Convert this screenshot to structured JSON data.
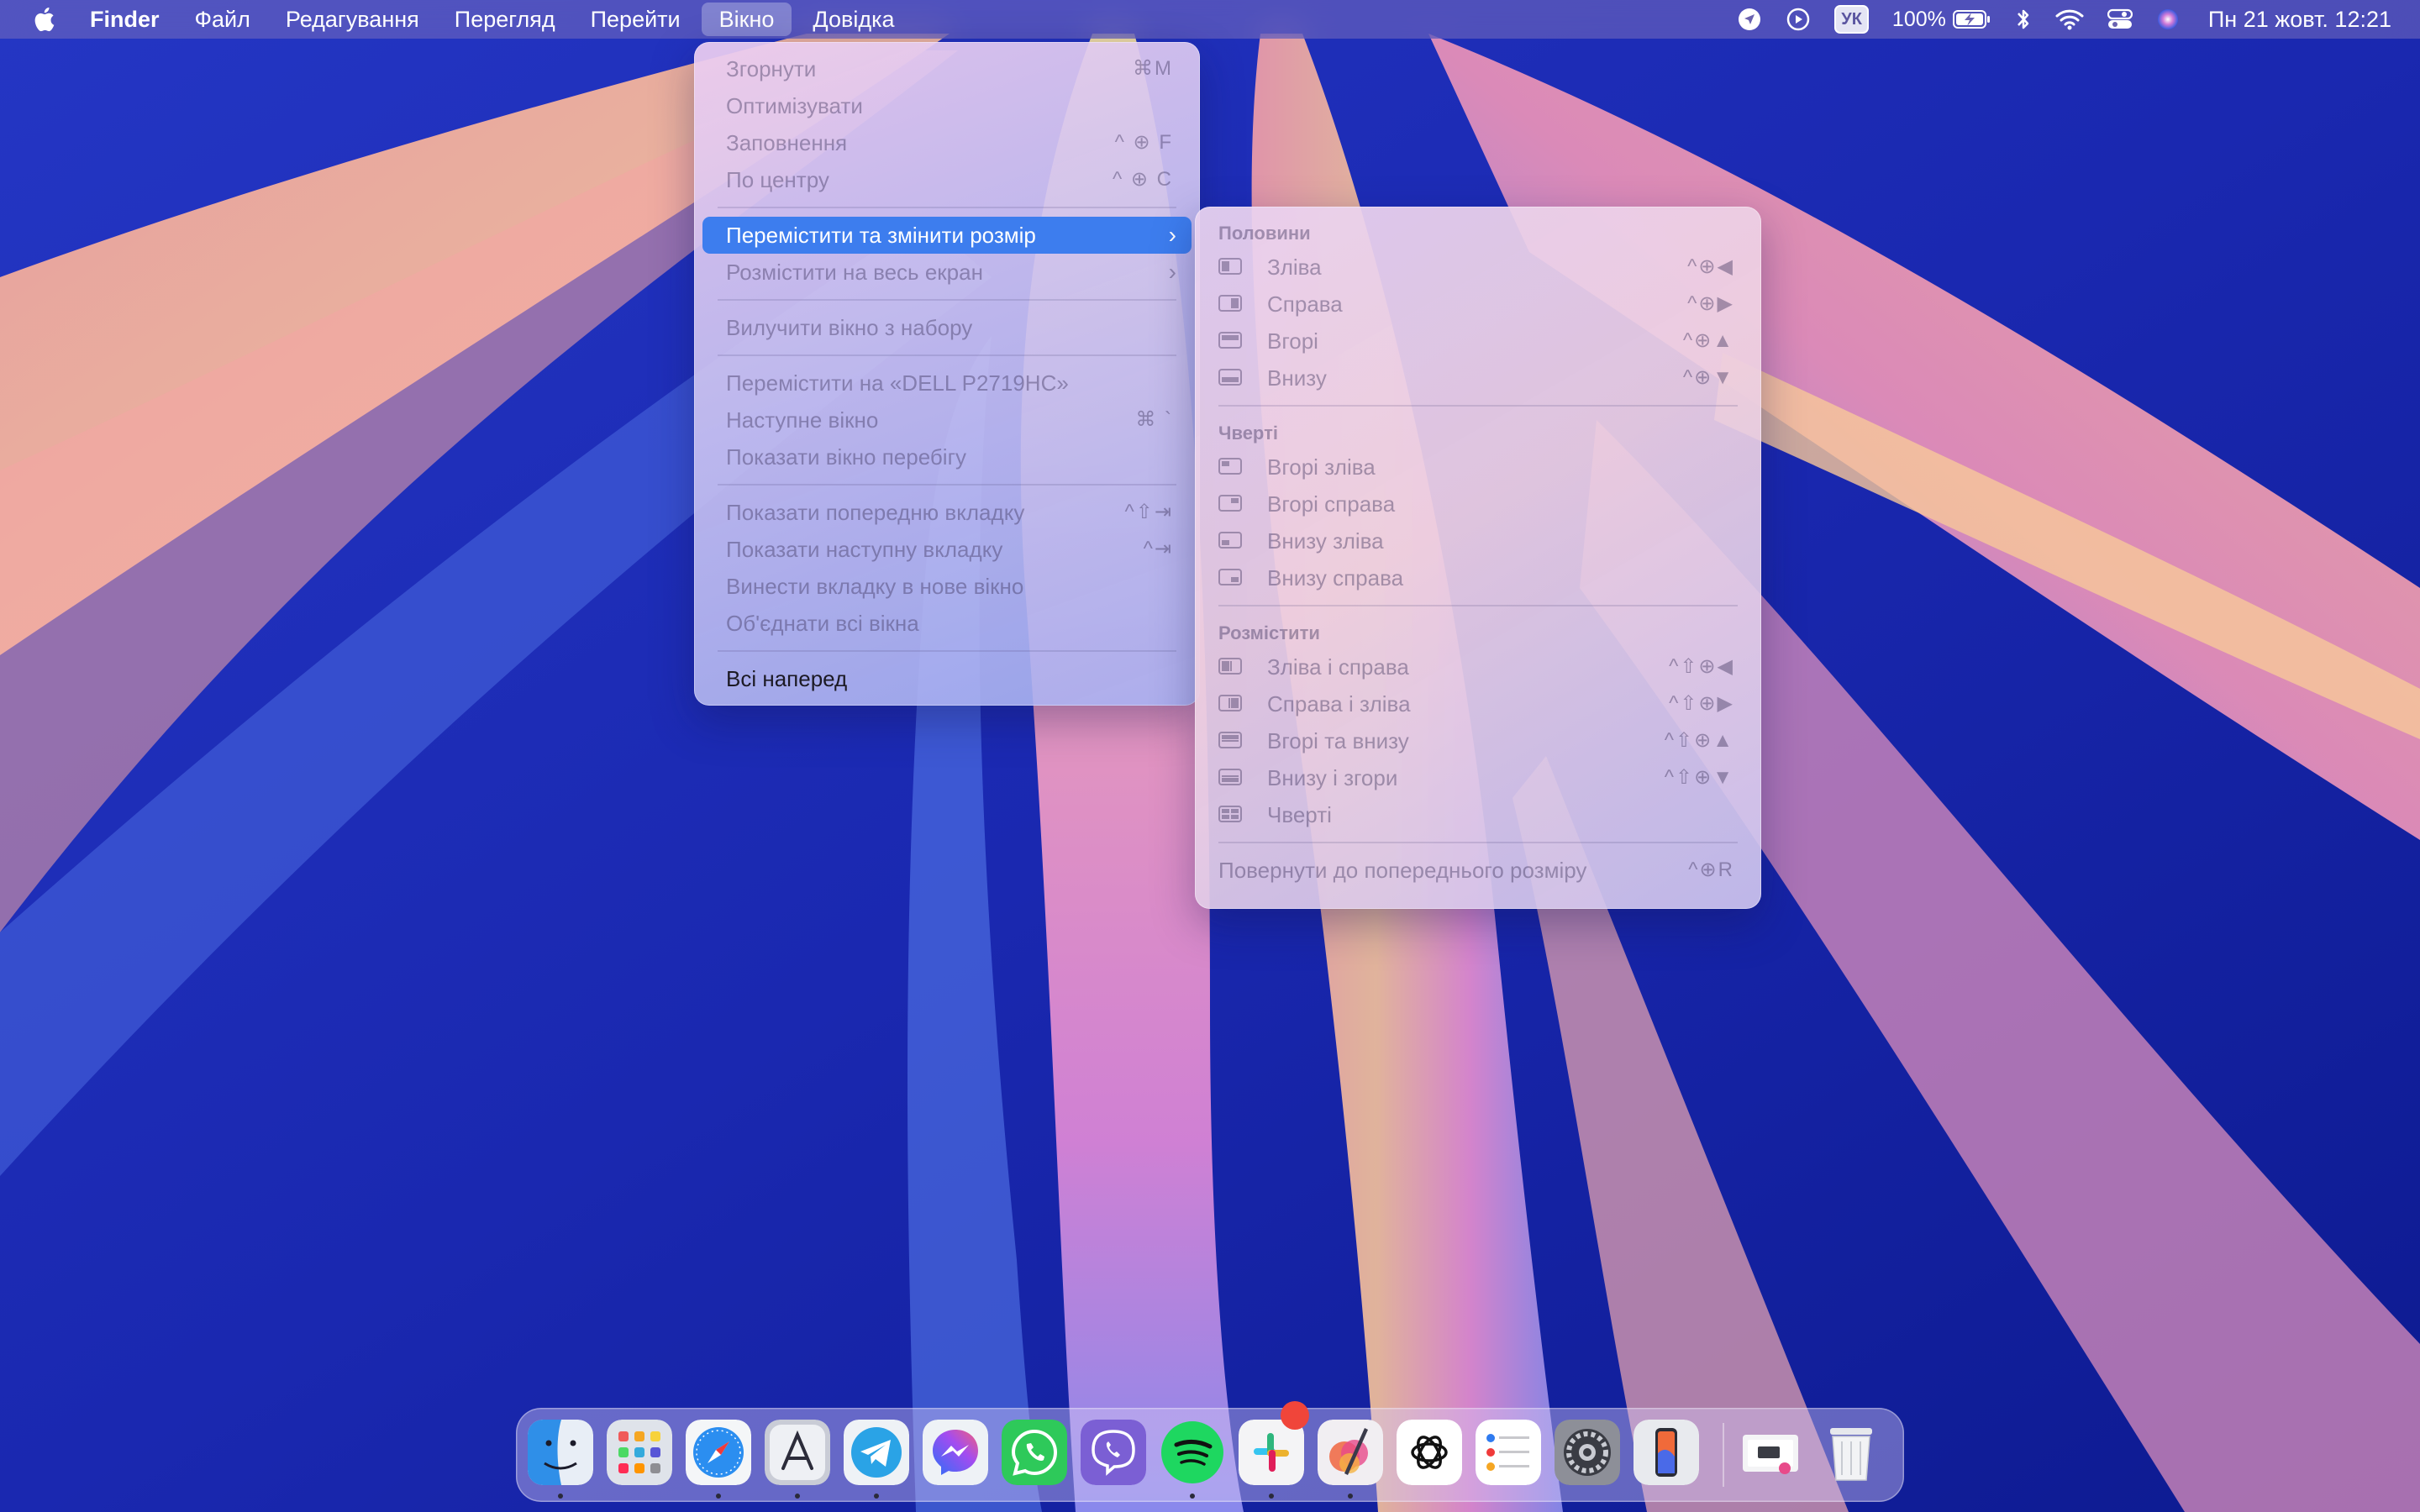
{
  "menubar": {
    "app_name": "Finder",
    "menus": [
      "Файл",
      "Редагування",
      "Перегляд",
      "Перейти",
      "Вікно",
      "Довідка"
    ],
    "active_menu": "Вікно",
    "status": {
      "keyboard_layout": "УК",
      "battery_percent": "100%",
      "clock": "Пн 21 жовт.  12:21"
    }
  },
  "window_menu": {
    "items": [
      {
        "label": "Згорнути",
        "shortcut": "⌘M"
      },
      {
        "label": "Оптимізувати",
        "shortcut": ""
      },
      {
        "label": "Заповнення",
        "shortcut": "^ ⊕ F"
      },
      {
        "label": "По центру",
        "shortcut": "^ ⊕ C"
      },
      {
        "label": "Перемістити та змінити розмір",
        "shortcut": ""
      },
      {
        "label": "Розмістити на весь екран",
        "shortcut": ""
      },
      {
        "label": "Вилучити вікно з набору",
        "shortcut": ""
      },
      {
        "label": "Перемістити на «DELL P2719HC»",
        "shortcut": ""
      },
      {
        "label": "Наступне вікно",
        "shortcut": "⌘ `"
      },
      {
        "label": "Показати вікно перебігу",
        "shortcut": ""
      },
      {
        "label": "Показати попередню вкладку",
        "shortcut": "^⇧⇥"
      },
      {
        "label": "Показати наступну вкладку",
        "shortcut": "^⇥"
      },
      {
        "label": "Винести вкладку в нове вікно",
        "shortcut": ""
      },
      {
        "label": "Об'єднати всі вікна",
        "shortcut": ""
      },
      {
        "label": "Всі наперед",
        "shortcut": ""
      }
    ]
  },
  "submenu": {
    "halves_header": "Половини",
    "halves": [
      {
        "label": "Зліва",
        "shortcut": "^⊕◀"
      },
      {
        "label": "Справа",
        "shortcut": "^⊕▶"
      },
      {
        "label": "Вгорі",
        "shortcut": "^⊕▲"
      },
      {
        "label": "Внизу",
        "shortcut": "^⊕▼"
      }
    ],
    "quarters_header": "Чверті",
    "quarters": [
      {
        "label": "Вгорі зліва"
      },
      {
        "label": "Вгорі справа"
      },
      {
        "label": "Внизу зліва"
      },
      {
        "label": "Внизу справа"
      }
    ],
    "arrange_header": "Розмістити",
    "arrange": [
      {
        "label": "Зліва і справа",
        "shortcut": "^⇧⊕◀"
      },
      {
        "label": "Справа і зліва",
        "shortcut": "^⇧⊕▶"
      },
      {
        "label": "Вгорі та внизу",
        "shortcut": "^⇧⊕▲"
      },
      {
        "label": "Внизу і згори",
        "shortcut": "^⇧⊕▼"
      },
      {
        "label": "Чверті",
        "shortcut": ""
      }
    ],
    "restore": {
      "label": "Повернути до попереднього розміру",
      "shortcut": "^⊕R"
    }
  },
  "dock": {
    "apps": [
      "finder-icon",
      "launchpad-icon",
      "safari-icon",
      "app-store-icon",
      "telegram-icon",
      "messenger-icon",
      "whatsapp-icon",
      "viber-icon",
      "spotify-icon",
      "slack-icon",
      "pixelmator-icon",
      "chatgpt-icon",
      "reminders-icon",
      "system-settings-icon",
      "iphone-mirroring-icon",
      "downloads-stack-icon",
      "trash-icon"
    ]
  }
}
